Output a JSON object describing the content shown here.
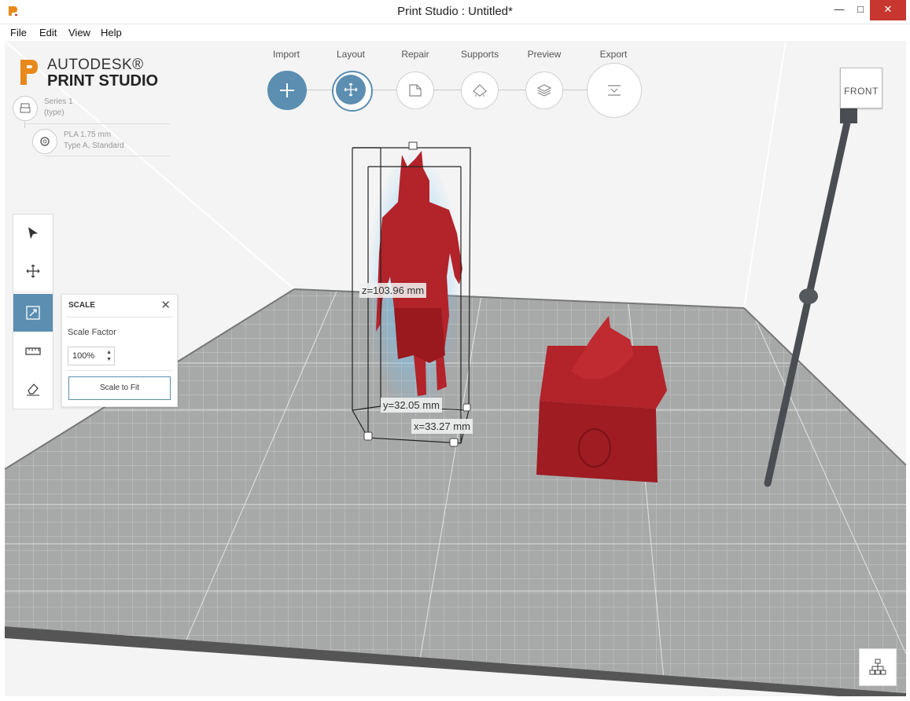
{
  "window": {
    "title": "Print Studio : Untitled*",
    "controls": [
      "—",
      "□",
      "✕"
    ]
  },
  "menu": {
    "file": "File",
    "edit": "Edit",
    "view": "View",
    "help": "Help"
  },
  "brand": {
    "line1": "AUTODESK®",
    "line2": "PRINT STUDIO"
  },
  "printer": {
    "name": "Series 1",
    "type": "(type)"
  },
  "material": {
    "name": "PLA 1.75 mm",
    "type": "Type A, Standard"
  },
  "workflow": {
    "steps": [
      {
        "label": "Import",
        "icon": "plus-icon",
        "state": "done"
      },
      {
        "label": "Layout",
        "icon": "move-icon",
        "state": "active"
      },
      {
        "label": "Repair",
        "icon": "repair-icon",
        "state": "pending"
      },
      {
        "label": "Supports",
        "icon": "supports-icon",
        "state": "pending"
      },
      {
        "label": "Preview",
        "icon": "layers-icon",
        "state": "pending"
      },
      {
        "label": "Export",
        "icon": "export-icon",
        "state": "pending"
      }
    ]
  },
  "tools": [
    {
      "name": "select",
      "icon": "cursor-icon",
      "active": false
    },
    {
      "name": "move",
      "icon": "move-icon",
      "active": false
    },
    {
      "name": "scale",
      "icon": "scale-icon",
      "active": true
    },
    {
      "name": "measure",
      "icon": "ruler-icon",
      "active": false
    },
    {
      "name": "eraser",
      "icon": "eraser-icon",
      "active": false
    }
  ],
  "scale_panel": {
    "title": "SCALE",
    "factor_label": "Scale Factor",
    "factor_value": "100%",
    "fit_button": "Scale to Fit"
  },
  "dimensions": {
    "z": "z=103.96 mm",
    "y": "y=32.05 mm",
    "x": "x=33.27 mm"
  },
  "viewcube": {
    "face": "FRONT"
  },
  "colors": {
    "accent": "#5b8eb0",
    "model": "#b3232a",
    "grid": "#8f9090"
  }
}
